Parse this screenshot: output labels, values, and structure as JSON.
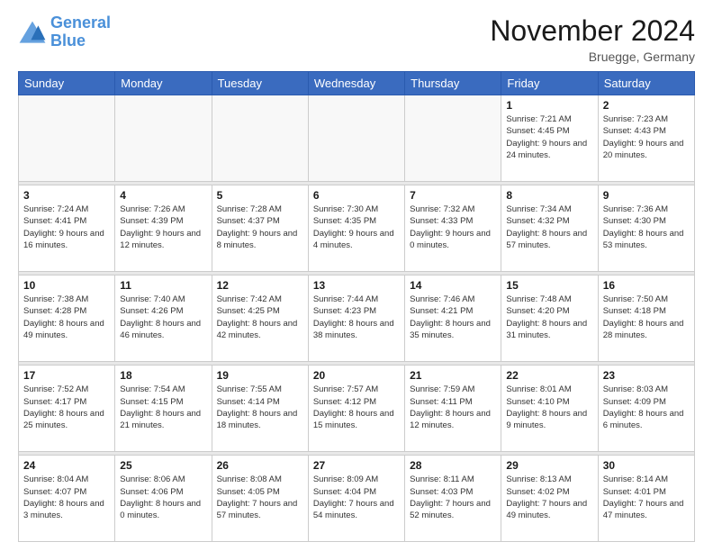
{
  "header": {
    "logo_line1": "General",
    "logo_line2": "Blue",
    "month_title": "November 2024",
    "subtitle": "Bruegge, Germany"
  },
  "days_of_week": [
    "Sunday",
    "Monday",
    "Tuesday",
    "Wednesday",
    "Thursday",
    "Friday",
    "Saturday"
  ],
  "weeks": [
    [
      {
        "day": "",
        "empty": true
      },
      {
        "day": "",
        "empty": true
      },
      {
        "day": "",
        "empty": true
      },
      {
        "day": "",
        "empty": true
      },
      {
        "day": "",
        "empty": true
      },
      {
        "day": "1",
        "sunrise": "7:21 AM",
        "sunset": "4:45 PM",
        "daylight": "9 hours and 24 minutes."
      },
      {
        "day": "2",
        "sunrise": "7:23 AM",
        "sunset": "4:43 PM",
        "daylight": "9 hours and 20 minutes."
      }
    ],
    [
      {
        "day": "3",
        "sunrise": "7:24 AM",
        "sunset": "4:41 PM",
        "daylight": "9 hours and 16 minutes."
      },
      {
        "day": "4",
        "sunrise": "7:26 AM",
        "sunset": "4:39 PM",
        "daylight": "9 hours and 12 minutes."
      },
      {
        "day": "5",
        "sunrise": "7:28 AM",
        "sunset": "4:37 PM",
        "daylight": "9 hours and 8 minutes."
      },
      {
        "day": "6",
        "sunrise": "7:30 AM",
        "sunset": "4:35 PM",
        "daylight": "9 hours and 4 minutes."
      },
      {
        "day": "7",
        "sunrise": "7:32 AM",
        "sunset": "4:33 PM",
        "daylight": "9 hours and 0 minutes."
      },
      {
        "day": "8",
        "sunrise": "7:34 AM",
        "sunset": "4:32 PM",
        "daylight": "8 hours and 57 minutes."
      },
      {
        "day": "9",
        "sunrise": "7:36 AM",
        "sunset": "4:30 PM",
        "daylight": "8 hours and 53 minutes."
      }
    ],
    [
      {
        "day": "10",
        "sunrise": "7:38 AM",
        "sunset": "4:28 PM",
        "daylight": "8 hours and 49 minutes."
      },
      {
        "day": "11",
        "sunrise": "7:40 AM",
        "sunset": "4:26 PM",
        "daylight": "8 hours and 46 minutes."
      },
      {
        "day": "12",
        "sunrise": "7:42 AM",
        "sunset": "4:25 PM",
        "daylight": "8 hours and 42 minutes."
      },
      {
        "day": "13",
        "sunrise": "7:44 AM",
        "sunset": "4:23 PM",
        "daylight": "8 hours and 38 minutes."
      },
      {
        "day": "14",
        "sunrise": "7:46 AM",
        "sunset": "4:21 PM",
        "daylight": "8 hours and 35 minutes."
      },
      {
        "day": "15",
        "sunrise": "7:48 AM",
        "sunset": "4:20 PM",
        "daylight": "8 hours and 31 minutes."
      },
      {
        "day": "16",
        "sunrise": "7:50 AM",
        "sunset": "4:18 PM",
        "daylight": "8 hours and 28 minutes."
      }
    ],
    [
      {
        "day": "17",
        "sunrise": "7:52 AM",
        "sunset": "4:17 PM",
        "daylight": "8 hours and 25 minutes."
      },
      {
        "day": "18",
        "sunrise": "7:54 AM",
        "sunset": "4:15 PM",
        "daylight": "8 hours and 21 minutes."
      },
      {
        "day": "19",
        "sunrise": "7:55 AM",
        "sunset": "4:14 PM",
        "daylight": "8 hours and 18 minutes."
      },
      {
        "day": "20",
        "sunrise": "7:57 AM",
        "sunset": "4:12 PM",
        "daylight": "8 hours and 15 minutes."
      },
      {
        "day": "21",
        "sunrise": "7:59 AM",
        "sunset": "4:11 PM",
        "daylight": "8 hours and 12 minutes."
      },
      {
        "day": "22",
        "sunrise": "8:01 AM",
        "sunset": "4:10 PM",
        "daylight": "8 hours and 9 minutes."
      },
      {
        "day": "23",
        "sunrise": "8:03 AM",
        "sunset": "4:09 PM",
        "daylight": "8 hours and 6 minutes."
      }
    ],
    [
      {
        "day": "24",
        "sunrise": "8:04 AM",
        "sunset": "4:07 PM",
        "daylight": "8 hours and 3 minutes."
      },
      {
        "day": "25",
        "sunrise": "8:06 AM",
        "sunset": "4:06 PM",
        "daylight": "8 hours and 0 minutes."
      },
      {
        "day": "26",
        "sunrise": "8:08 AM",
        "sunset": "4:05 PM",
        "daylight": "7 hours and 57 minutes."
      },
      {
        "day": "27",
        "sunrise": "8:09 AM",
        "sunset": "4:04 PM",
        "daylight": "7 hours and 54 minutes."
      },
      {
        "day": "28",
        "sunrise": "8:11 AM",
        "sunset": "4:03 PM",
        "daylight": "7 hours and 52 minutes."
      },
      {
        "day": "29",
        "sunrise": "8:13 AM",
        "sunset": "4:02 PM",
        "daylight": "7 hours and 49 minutes."
      },
      {
        "day": "30",
        "sunrise": "8:14 AM",
        "sunset": "4:01 PM",
        "daylight": "7 hours and 47 minutes."
      }
    ]
  ],
  "labels": {
    "sunrise": "Sunrise:",
    "sunset": "Sunset:",
    "daylight": "Daylight:"
  }
}
